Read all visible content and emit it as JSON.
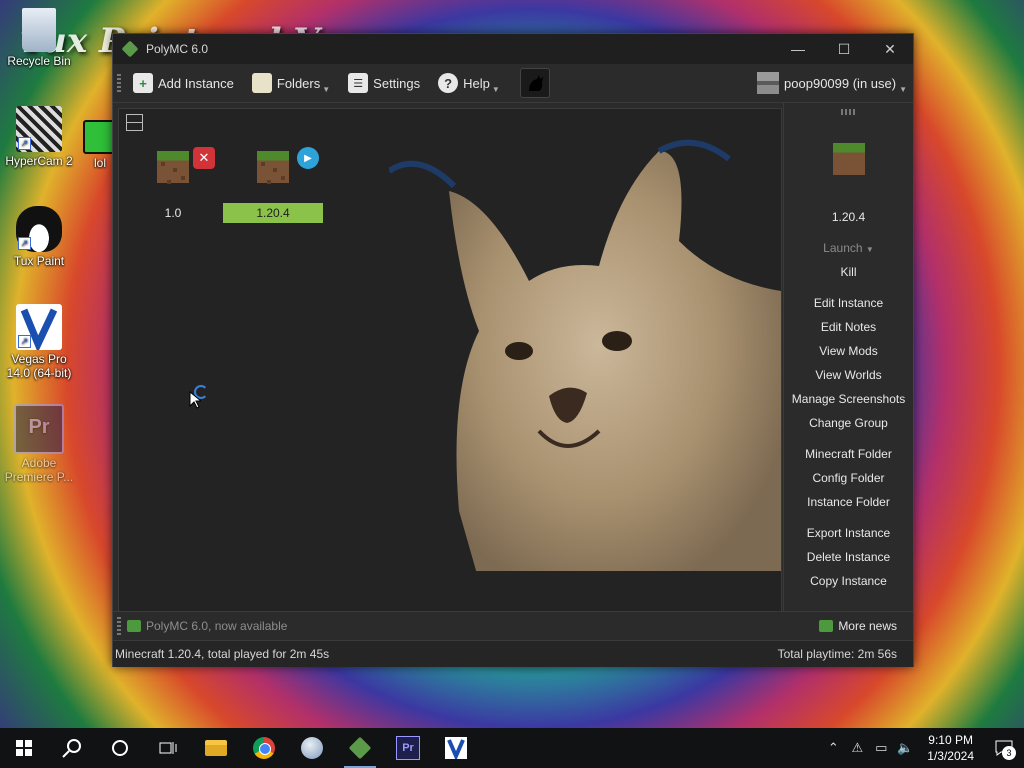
{
  "desktop": {
    "icons": [
      {
        "label": "Recycle Bin"
      },
      {
        "label": "HyperCam 2"
      },
      {
        "label": "lol"
      },
      {
        "label": "Tux Paint"
      },
      {
        "label": "Vegas Pro 14.0 (64-bit)"
      },
      {
        "label": "Adobe Premiere P..."
      }
    ],
    "wallpaper_text": "Tux Paint and Vegas"
  },
  "window": {
    "title": "PolyMC 6.0",
    "controls": {
      "minimize": "—",
      "maximize": "☐",
      "close": "✕"
    }
  },
  "toolbar": {
    "add_instance": "Add Instance",
    "folders": "Folders",
    "settings": "Settings",
    "help": "Help",
    "account": "poop90099 (in use)"
  },
  "instances": [
    {
      "name": "1.0",
      "badge": "✕",
      "badge_color": "#d13438",
      "selected": false
    },
    {
      "name": "1.20.4",
      "badge": "▶",
      "badge_color": "#2ea3d9",
      "selected": true
    }
  ],
  "sidebar": {
    "instance_name": "1.20.4",
    "launch": "Launch",
    "kill": "Kill",
    "actions": {
      "edit_instance": "Edit Instance",
      "edit_notes": "Edit Notes",
      "view_mods": "View Mods",
      "view_worlds": "View Worlds",
      "manage_screenshots": "Manage Screenshots",
      "change_group": "Change Group",
      "minecraft_folder": "Minecraft Folder",
      "config_folder": "Config Folder",
      "instance_folder": "Instance Folder",
      "export_instance": "Export Instance",
      "delete_instance": "Delete Instance",
      "copy_instance": "Copy Instance"
    }
  },
  "news": {
    "headline": "PolyMC 6.0, now available",
    "more": "More news"
  },
  "status": {
    "left": "Minecraft 1.20.4, total played for 2m 45s",
    "right": "Total playtime: 2m 56s"
  },
  "taskbar": {
    "time": "9:10 PM",
    "date": "1/3/2024",
    "notification_count": "3"
  },
  "colors": {
    "accent_green": "#8bc34a",
    "window_bg": "#2b2b2b",
    "taskbar_bg": "#111214"
  }
}
